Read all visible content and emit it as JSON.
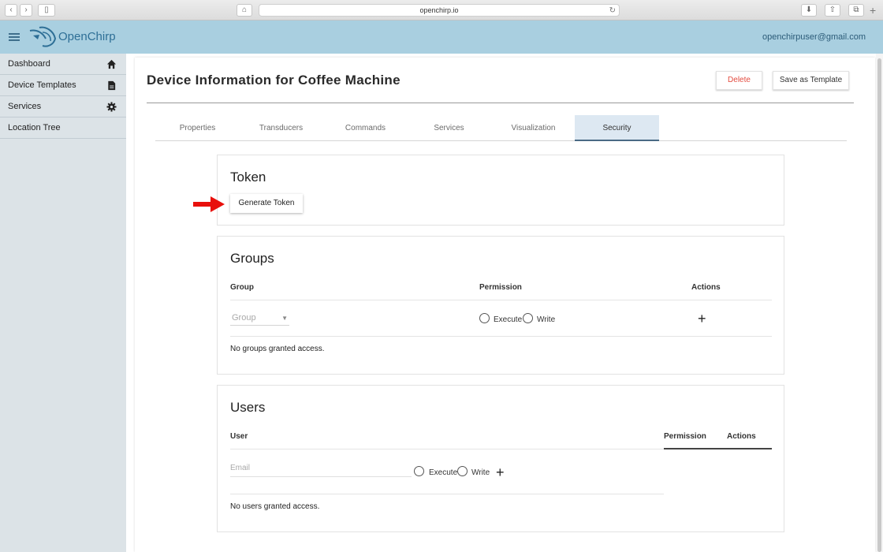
{
  "browser": {
    "url": "openchirp.io"
  },
  "header": {
    "brand": "OpenChirp",
    "user_email": "openchirpuser@gmail.com"
  },
  "sidebar": {
    "items": [
      {
        "label": "Dashboard",
        "icon": "home-icon"
      },
      {
        "label": "Device Templates",
        "icon": "document-icon"
      },
      {
        "label": "Services",
        "icon": "gear-icon"
      },
      {
        "label": "Location Tree",
        "icon": ""
      }
    ]
  },
  "page": {
    "title": "Device Information for Coffee Machine",
    "delete_label": "Delete",
    "save_template_label": "Save as Template"
  },
  "tabs": [
    {
      "label": "Properties"
    },
    {
      "label": "Transducers"
    },
    {
      "label": "Commands"
    },
    {
      "label": "Services"
    },
    {
      "label": "Visualization"
    },
    {
      "label": "Security",
      "active": true
    }
  ],
  "token": {
    "title": "Token",
    "generate_label": "Generate Token"
  },
  "groups": {
    "title": "Groups",
    "col_group": "Group",
    "col_permission": "Permission",
    "col_actions": "Actions",
    "group_placeholder": "Group",
    "execute_label": "Execute",
    "write_label": "Write",
    "empty_text": "No groups granted access."
  },
  "users": {
    "title": "Users",
    "col_user": "User",
    "col_permission": "Permission",
    "col_actions": "Actions",
    "email_placeholder": "Email",
    "execute_label": "Execute",
    "write_label": "Write",
    "empty_text": "No users granted access."
  },
  "colors": {
    "header_bg": "#a9cfe0",
    "sidebar_bg": "#dce3e7",
    "delete_red": "#e34b3f",
    "active_tab": "#dde8f2",
    "arrow_red": "#e8100c"
  }
}
